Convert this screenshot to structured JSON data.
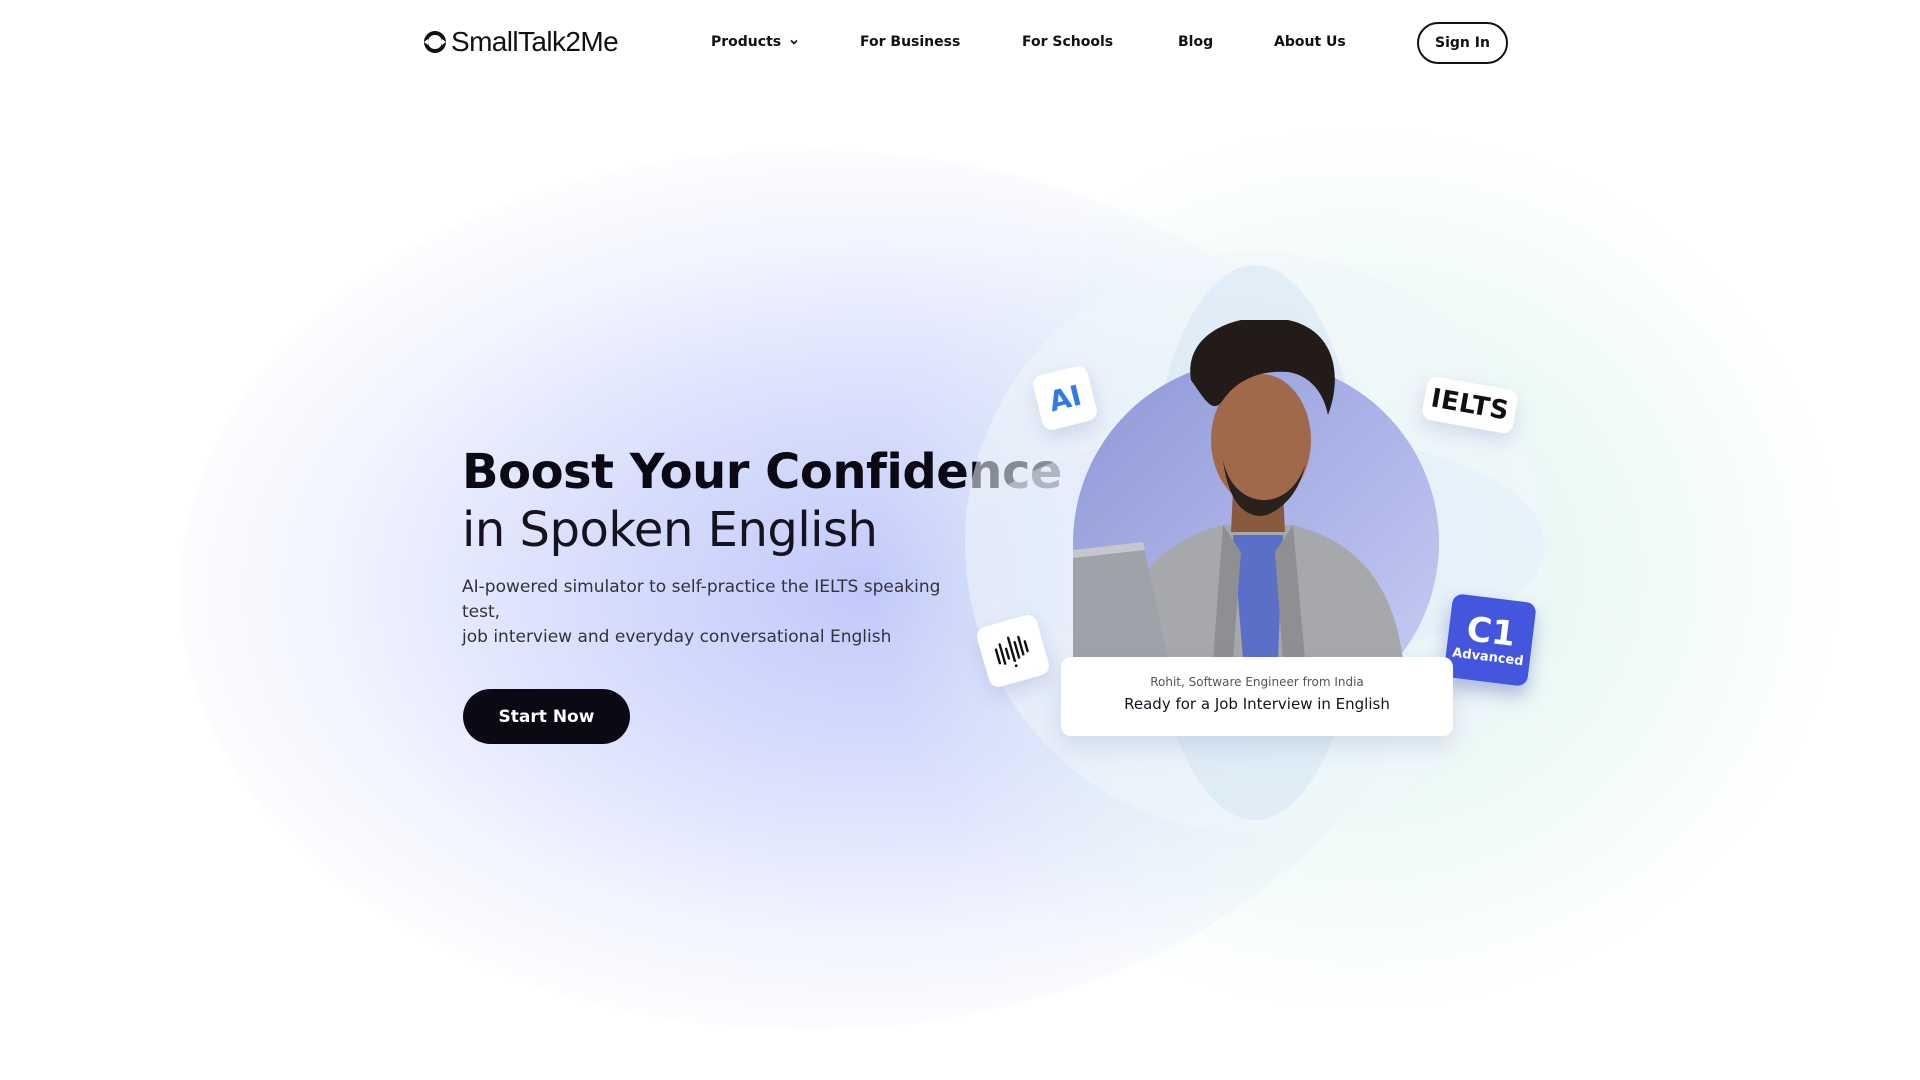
{
  "header": {
    "logo_text": "SmallTalk2Me",
    "nav": [
      {
        "label": "Products",
        "has_dropdown": true
      },
      {
        "label": "For Business"
      },
      {
        "label": "For Schools"
      },
      {
        "label": "Blog"
      },
      {
        "label": "About Us"
      }
    ],
    "sign_in_label": "Sign In"
  },
  "hero": {
    "title_bold": "Boost Your Confidence",
    "title_light": "in Spoken English",
    "subtitle_line1": "AI-powered simulator to self-practice the IELTS speaking test,",
    "subtitle_line2": "job interview and everyday conversational English",
    "cta_label": "Start Now"
  },
  "visual": {
    "chips": {
      "ai": "AI",
      "ielts": "IELTS",
      "level_code": "C1",
      "level_name": "Advanced",
      "wave_icon": "soundwave-icon"
    },
    "caption": {
      "person": "Rohit, Software Engineer from India",
      "headline": "Ready for a Job Interview in English"
    },
    "colors": {
      "accent_blue": "#4456de",
      "ai_blue": "#2f7ce8",
      "dark": "#0b0a14"
    }
  }
}
